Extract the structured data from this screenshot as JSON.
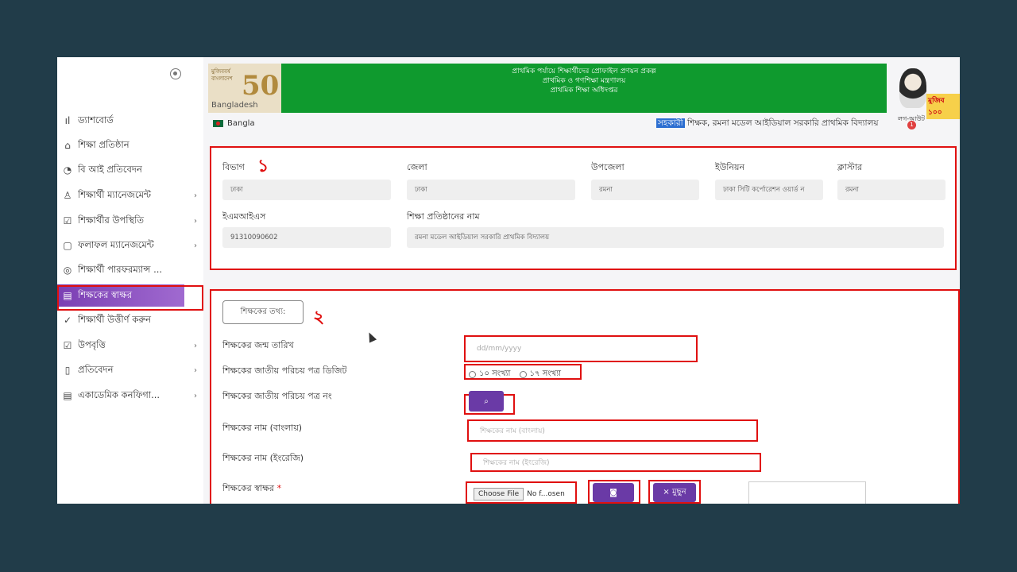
{
  "sidebar": {
    "items": [
      {
        "icon": "bar-chart-icon",
        "glyph": "ıl",
        "label": "ড্যাশবোর্ড",
        "chevron": ""
      },
      {
        "icon": "home-icon",
        "glyph": "⌂",
        "label": "শিক্ষা প্রতিষ্ঠান",
        "chevron": ""
      },
      {
        "icon": "pie-chart-icon",
        "glyph": "◔",
        "label": "বি আই প্রতিবেদন",
        "chevron": ""
      },
      {
        "icon": "user-icon",
        "glyph": "♙",
        "label": "শিক্ষার্থী ম্যানেজমেন্ট",
        "chevron": "›"
      },
      {
        "icon": "checkbox-icon",
        "glyph": "☑",
        "label": "শিক্ষার্থীর উপস্থিতি",
        "chevron": "›"
      },
      {
        "icon": "clipboard-icon",
        "glyph": "▢",
        "label": "ফলাফল ম্যানেজমেন্ট",
        "chevron": "›"
      },
      {
        "icon": "target-icon",
        "glyph": "◎",
        "label": "শিক্ষার্থী পারফরম্যান্স ...",
        "chevron": ""
      },
      {
        "icon": "document-icon",
        "glyph": "▤",
        "label": "শিক্ষকের স্বাক্ষর",
        "chevron": ""
      },
      {
        "icon": "check-circle-icon",
        "glyph": "✓",
        "label": "শিক্ষার্থী উত্তীর্ণ করুন",
        "chevron": ""
      },
      {
        "icon": "checkbox-icon",
        "glyph": "☑",
        "label": "উপবৃত্তি",
        "chevron": "›"
      },
      {
        "icon": "file-icon",
        "glyph": "▯",
        "label": "প্রতিবেদন",
        "chevron": "›"
      },
      {
        "icon": "document-icon",
        "glyph": "▤",
        "label": "একাডেমিক কনফিগা...",
        "chevron": "›"
      }
    ]
  },
  "header": {
    "logo_tag": "মুজিববর্ষ বাংলাদেশ",
    "logo_number": "50",
    "logo_country": "Bangladesh",
    "banner_line1": "প্রাথমিক পর্যায়ে শিক্ষার্থীদের প্রোফাইল প্রণয়ন প্রকল্প",
    "banner_line2": "প্রাথমিক ও গণশিক্ষা মন্ত্রণালয়",
    "banner_line3": "প্রাথমিক শিক্ষা অধিদপ্তর",
    "mujib_badge": "মুজিব ১০০"
  },
  "subbar": {
    "language": "Bangla",
    "role_highlight": "সহকারী",
    "user_text": " শিক্ষক, রমনা মডেল আইডিয়াল সরকারি প্রাথমিক বিদ্যালয়",
    "logout": "লগ-আউট",
    "notification_count": "1"
  },
  "section1": {
    "annotation": "১",
    "fields": {
      "division": {
        "label": "বিভাগ",
        "value": "ঢাকা"
      },
      "district": {
        "label": "জেলা",
        "value": "ঢাকা"
      },
      "upazila": {
        "label": "উপজেলা",
        "value": "রমনা"
      },
      "union": {
        "label": "ইউনিয়ন",
        "value": "ঢাকা সিটি কর্পোরেশন ওয়ার্ড ন"
      },
      "cluster": {
        "label": "ক্লাস্টার",
        "value": "রমনা"
      },
      "emis": {
        "label": "ইএমআইএস",
        "value": "91310090602"
      },
      "institution": {
        "label": "শিক্ষা প্রতিষ্ঠানের নাম",
        "value": "রমনা মডেল আইডিয়াল সরকারি প্রাথমিক বিদ্যালয়"
      }
    }
  },
  "section2": {
    "annotation": "২",
    "info_button": "শিক্ষকের তথ্য:",
    "dob_label": "শিক্ষকের জন্ম তারিখ",
    "dob_placeholder": "dd/mm/yyyy",
    "nid_digit_label": "শিক্ষকের জাতীয় পরিচয় পত্র ডিজিট",
    "nid_option_10": "১০ সংখ্যা",
    "nid_option_17": "১৭ সংখ্যা",
    "nid_number_label": "শিক্ষকের জাতীয় পরিচয় পত্র নং",
    "name_bn_label": "শিক্ষকের নাম (বাংলায়)",
    "name_bn_placeholder": "শিক্ষকের নাম (বাংলায়)",
    "name_en_label": "শিক্ষকের নাম (ইংরেজি)",
    "name_en_placeholder": "শিক্ষকের নাম (ইংরেজি)",
    "signature_label": "শিক্ষকের স্বাক্ষর",
    "required_mark": "*",
    "choose_file": "Choose File",
    "no_file": "No f...osen",
    "remove_button": "× মুছুন"
  }
}
